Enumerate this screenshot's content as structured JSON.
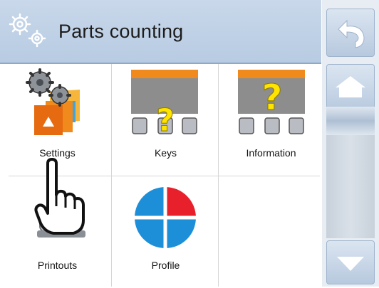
{
  "header": {
    "title": "Parts counting",
    "icon": "gears-icon"
  },
  "tiles": [
    {
      "label": "Settings",
      "icon": "settings-gears-icon"
    },
    {
      "label": "Keys",
      "icon": "keys-icon"
    },
    {
      "label": "Information",
      "icon": "information-icon"
    },
    {
      "label": "Printouts",
      "icon": "printer-icon"
    },
    {
      "label": "Profile",
      "icon": "profile-icon"
    }
  ],
  "sidebar": {
    "buttons": [
      "back-icon",
      "home-icon",
      "scroll-down-icon"
    ]
  },
  "colors": {
    "header_bg": "#c9d8ea",
    "accent_orange": "#f08a1c",
    "profile_red": "#e8202c",
    "profile_blue": "#1d8fd8",
    "question_yellow": "#ffe400"
  }
}
